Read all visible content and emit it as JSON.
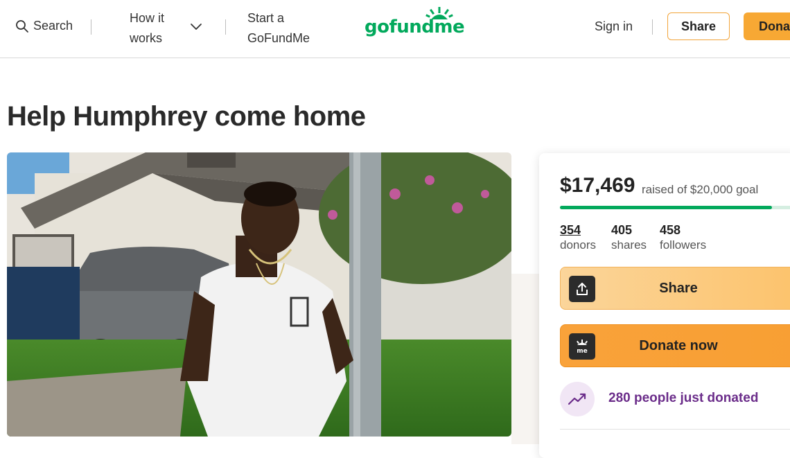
{
  "header": {
    "search_label": "Search",
    "how_it_works_line1": "How it",
    "how_it_works_line2": "works",
    "start_line1": "Start a",
    "start_line2": "GoFundMe",
    "logo_text": "gofundme",
    "sign_in": "Sign in",
    "share_label": "Share",
    "donate_label": "Donate"
  },
  "campaign": {
    "title": "Help Humphrey come home"
  },
  "donation_card": {
    "amount_raised": "$17,469",
    "goal_text": "raised of $20,000 goal",
    "progress_fraction": 0.873,
    "stats": [
      {
        "value": "354",
        "label": "donors"
      },
      {
        "value": "405",
        "label": "shares"
      },
      {
        "value": "458",
        "label": "followers"
      }
    ],
    "share_button": "Share",
    "donate_button": "Donate now",
    "recent_activity": "280 people just donated"
  },
  "colors": {
    "brand_green": "#02a95c",
    "accent_orange": "#f7a834",
    "activity_purple": "#6b2d8a"
  },
  "icons": [
    "search-icon",
    "chevron-down-icon",
    "share-upload-icon",
    "gofundme-heart-icon",
    "trending-up-icon"
  ]
}
